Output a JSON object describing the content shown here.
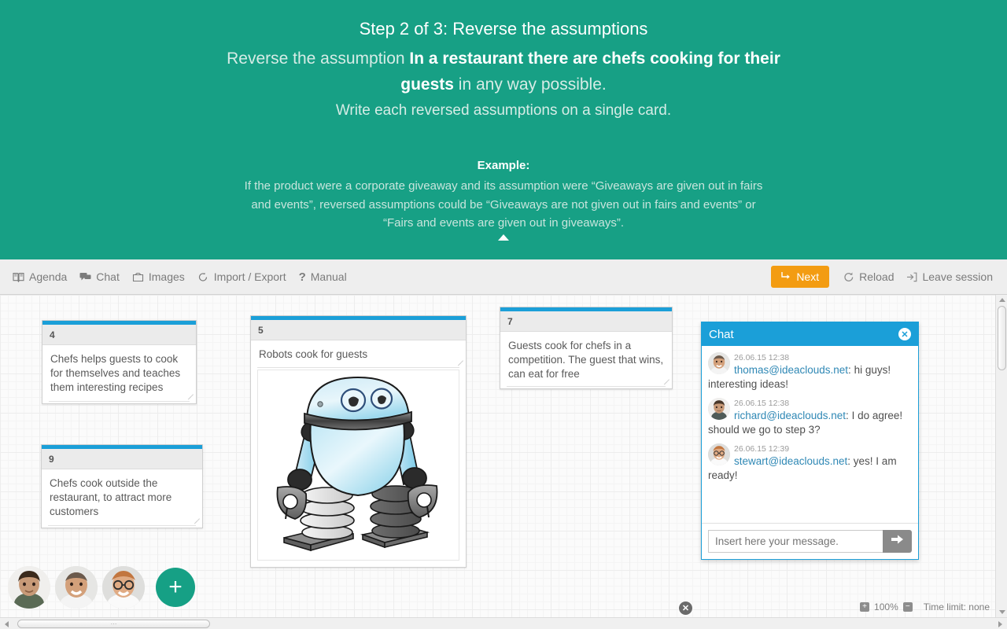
{
  "header": {
    "title": "Step 2 of 3: Reverse the assumptions",
    "instruction_prefix": "Reverse the assumption ",
    "instruction_bold": "In a restaurant there are chefs cooking for their guests",
    "instruction_suffix": " in any way possible.",
    "instruction_line3": "Write each reversed assumptions on a single card.",
    "example_title": "Example:",
    "example_body": "If the product were a corporate giveaway and its assumption were “Giveaways are given out in fairs and events”, reversed assumptions could be “Giveaways are not given out in fairs and events” or “Fairs and events are given out in giveaways”.",
    "collapse_icon": "triangle-up-icon",
    "bg_color": "#17a085"
  },
  "toolbar": {
    "left_items": [
      {
        "label": "Agenda",
        "icon": "book-icon"
      },
      {
        "label": "Chat",
        "icon": "chat-bubbles-icon"
      },
      {
        "label": "Images",
        "icon": "image-folder-icon"
      },
      {
        "label": "Import / Export",
        "icon": "refresh-cycle-icon"
      },
      {
        "label": "Manual",
        "icon": "question-mark-icon"
      }
    ],
    "next_label": "Next",
    "next_icon": "arrow-turn-right-icon",
    "next_color": "#f39c12",
    "reload_label": "Reload",
    "reload_icon": "reload-icon",
    "leave_label": "Leave session",
    "leave_icon": "leave-session-icon"
  },
  "cards": [
    {
      "number": "4",
      "text": "Chefs helps guests to cook for themselves and teaches them interesting recipes",
      "accent": "#1b9fd8"
    },
    {
      "number": "9",
      "text": "Chefs cook outside the restaurant, to attract more customers",
      "accent": "#1b9fd8"
    },
    {
      "number": "5",
      "text": "Robots cook for guests",
      "accent": "#1b9fd8",
      "image": "robot-illustration"
    },
    {
      "number": "7",
      "text": "Guests cook for chefs in a competition. The guest that wins, can eat for free",
      "accent": "#1b9fd8",
      "close_icon": "close-circle-icon"
    }
  ],
  "chat": {
    "title": "Chat",
    "close_icon": "close-circle-icon",
    "accent": "#1b9fd8",
    "messages": [
      {
        "time": "26.06.15 12:38",
        "user": "thomas@ideaclouds.net",
        "separator": ": ",
        "text": "hi guys! interesting ideas!",
        "avatar": "avatar-thomas"
      },
      {
        "time": "26.06.15 12:38",
        "user": "richard@ideaclouds.net",
        "separator": ": ",
        "text": "I do agree! should we go to step 3?",
        "avatar": "avatar-richard"
      },
      {
        "time": "26.06.15 12:39",
        "user": "stewart@ideaclouds.net",
        "separator": ": ",
        "text": "yes! I am ready!",
        "avatar": "avatar-stewart"
      }
    ],
    "input_placeholder": "Insert here your message.",
    "input_value": "",
    "send_icon": "arrow-right-icon"
  },
  "participants": {
    "avatars": [
      "avatar-participant-1",
      "avatar-participant-2",
      "avatar-participant-3"
    ],
    "add_label": "+"
  },
  "status": {
    "zoom_in_icon": "plus-icon",
    "zoom_out_icon": "minus-icon",
    "zoom_level": "100%",
    "time_limit": "Time limit: none"
  }
}
